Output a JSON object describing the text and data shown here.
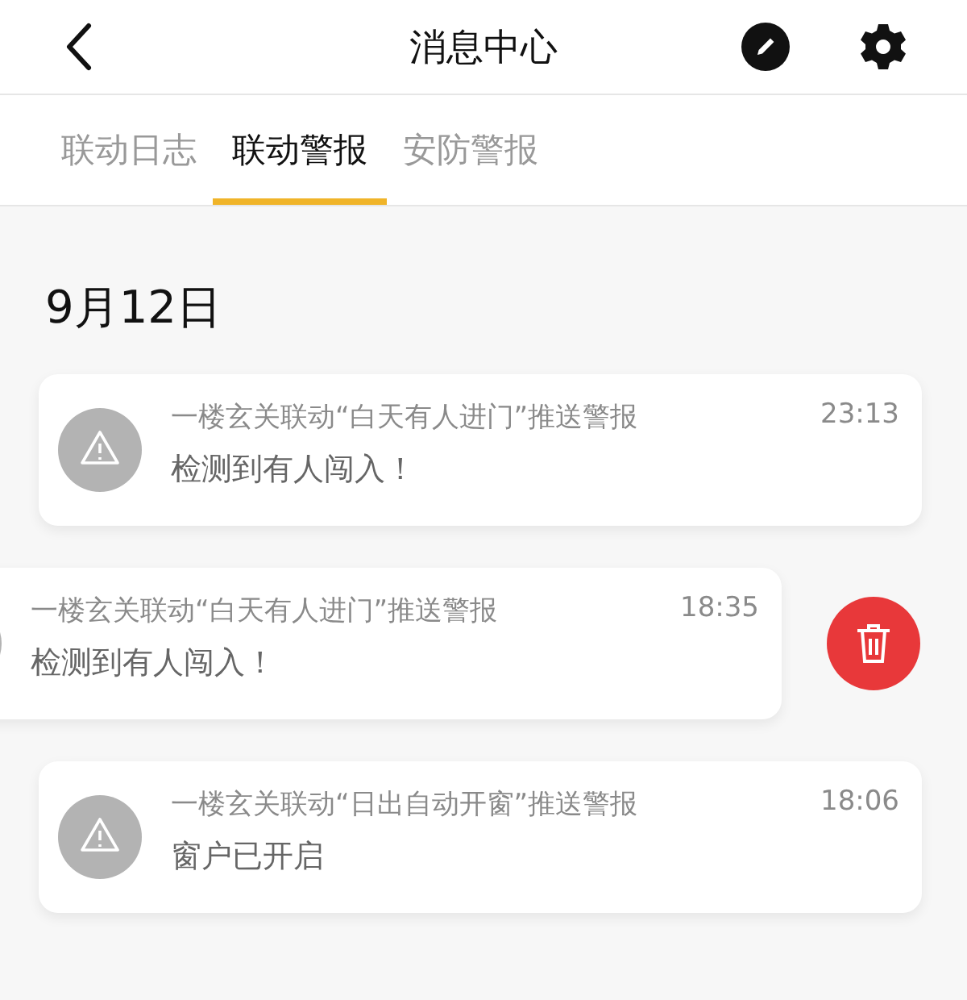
{
  "header": {
    "title": "消息中心"
  },
  "tabs": [
    {
      "label": "联动日志",
      "selected": false
    },
    {
      "label": "联动警报",
      "selected": true
    },
    {
      "label": "安防警报",
      "selected": false
    }
  ],
  "date": "9月12日",
  "messages": [
    {
      "title": "一楼玄关联动“白天有人进门”推送警报",
      "time": "23:13",
      "body": "检测到有人闯入！",
      "swiped": false
    },
    {
      "title": "一楼玄关联动“白天有人进门”推送警报",
      "time": "18:35",
      "body": "检测到有人闯入！",
      "swiped": true
    },
    {
      "title": "一楼玄关联动“日出自动开窗”推送警报",
      "time": "18:06",
      "body": "窗户已开启",
      "swiped": false
    }
  ]
}
